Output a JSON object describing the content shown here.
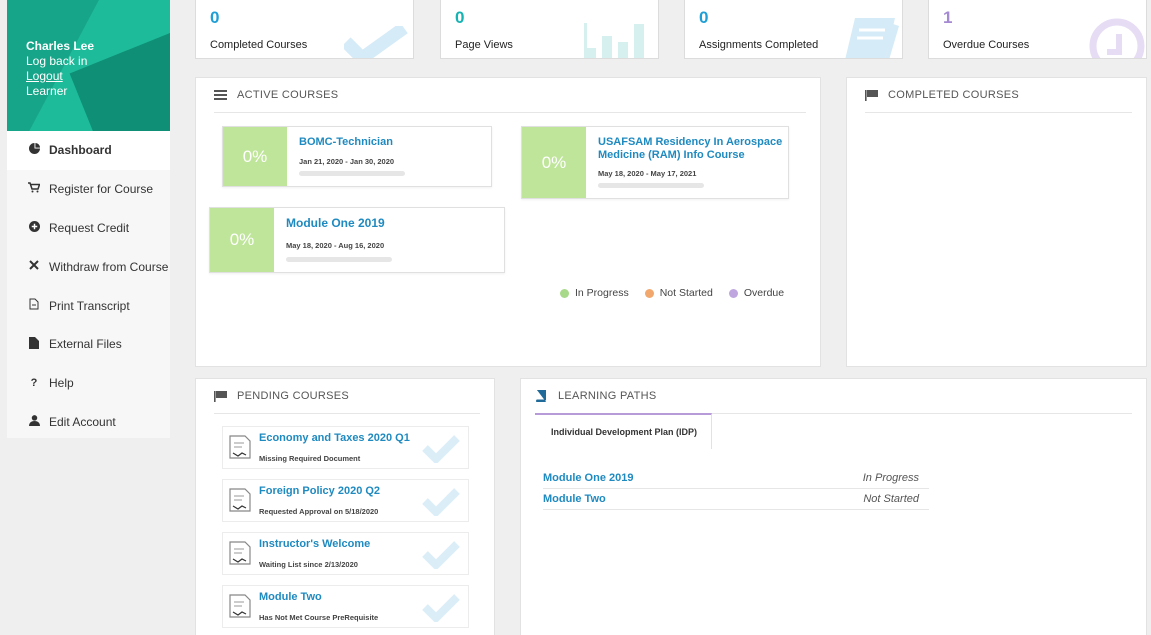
{
  "profile": {
    "name": "Charles Lee",
    "log_back": "Log back in",
    "logout": "Logout",
    "role": "Learner"
  },
  "nav": [
    {
      "label": "Dashboard",
      "icon": "pie-chart-icon"
    },
    {
      "label": "Register for Course",
      "icon": "cart-icon"
    },
    {
      "label": "Request Credit",
      "icon": "plus-circle-icon"
    },
    {
      "label": "Withdraw from Course",
      "icon": "close-icon"
    },
    {
      "label": "Print Transcript",
      "icon": "document-icon"
    },
    {
      "label": "External Files",
      "icon": "file-icon"
    },
    {
      "label": "Help",
      "icon": "question-icon"
    },
    {
      "label": "Edit Account",
      "icon": "user-icon"
    }
  ],
  "stats": [
    {
      "value": "0",
      "label": "Completed Courses",
      "color": "#1f9fd6"
    },
    {
      "value": "0",
      "label": "Page Views",
      "color": "#17b3b3"
    },
    {
      "value": "0",
      "label": "Assignments Completed",
      "color": "#1f9fd6"
    },
    {
      "value": "1",
      "label": "Overdue Courses",
      "color": "#a48ad2"
    }
  ],
  "active": {
    "heading": "ACTIVE COURSES",
    "courses": [
      {
        "pct": "0%",
        "title": "BOMC-Technician",
        "dates": "Jan 21, 2020 - Jan 30, 2020"
      },
      {
        "pct": "0%",
        "title": "USAFSAM Residency In Aerospace Medicine (RAM) Info Course",
        "title_l1": "USAFSAM Residency In Aerospace",
        "title_l2": "Medicine (RAM) Info Course",
        "dates": "May 18, 2020 - May 17, 2021"
      },
      {
        "pct": "0%",
        "title": "Module One 2019",
        "dates": "May 18, 2020 - Aug 16, 2020"
      }
    ],
    "legend": [
      {
        "label": "In Progress",
        "color": "#a8d98a"
      },
      {
        "label": "Not Started",
        "color": "#f2a86c"
      },
      {
        "label": "Overdue",
        "color": "#bfa6de"
      }
    ]
  },
  "completed": {
    "heading": "COMPLETED COURSES"
  },
  "pending": {
    "heading": "PENDING COURSES",
    "items": [
      {
        "title": "Economy and Taxes 2020 Q1",
        "sub": "Missing Required Document"
      },
      {
        "title": "Foreign Policy 2020 Q2",
        "sub": "Requested Approval on 5/18/2020"
      },
      {
        "title": "Instructor's Welcome",
        "sub": "Waiting List since 2/13/2020"
      },
      {
        "title": "Module Two",
        "sub": "Has Not Met Course PreRequisite"
      }
    ]
  },
  "paths": {
    "heading": "LEARNING PATHS",
    "tab": "Individual Development Plan (IDP)",
    "rows": [
      {
        "name": "Module One 2019",
        "status": "In Progress"
      },
      {
        "name": "Module Two",
        "status": "Not Started"
      }
    ]
  }
}
